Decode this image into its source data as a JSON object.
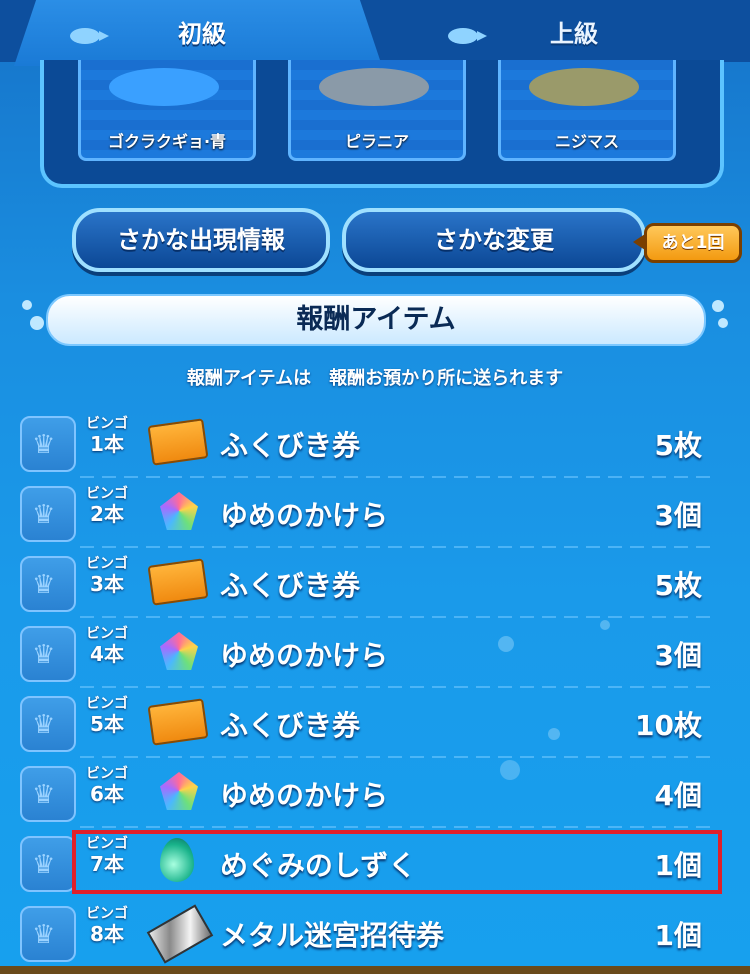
{
  "tabs": [
    {
      "label": "初級",
      "active": true,
      "icon": "fish-icon"
    },
    {
      "label": "上級",
      "active": false,
      "icon": "fish-icon"
    }
  ],
  "fish": [
    {
      "name": "ゴクラクギョ·青",
      "color": "#3aa0ff"
    },
    {
      "name": "ピラニア",
      "color": "#8a9aa8"
    },
    {
      "name": "ニジマス",
      "color": "#9a9a6a"
    }
  ],
  "buttons": {
    "appearance_info": "さかな出現情報",
    "change_fish": "さかな変更",
    "remaining": "あと1回"
  },
  "reward_section": {
    "title": "報酬アイテム",
    "note": "報酬アイテムは　報酬お預かり所に送られます"
  },
  "rewards": [
    {
      "bingo_l1": "ビンゴ",
      "bingo_l2": "1本",
      "icon": "ticket-icon",
      "name": "ふくびき券",
      "qty": "5枚"
    },
    {
      "bingo_l1": "ビンゴ",
      "bingo_l2": "2本",
      "icon": "gem-icon",
      "name": "ゆめのかけら",
      "qty": "3個"
    },
    {
      "bingo_l1": "ビンゴ",
      "bingo_l2": "3本",
      "icon": "ticket-icon",
      "name": "ふくびき券",
      "qty": "5枚"
    },
    {
      "bingo_l1": "ビンゴ",
      "bingo_l2": "4本",
      "icon": "gem-icon",
      "name": "ゆめのかけら",
      "qty": "3個"
    },
    {
      "bingo_l1": "ビンゴ",
      "bingo_l2": "5本",
      "icon": "ticket-icon",
      "name": "ふくびき券",
      "qty": "10枚"
    },
    {
      "bingo_l1": "ビンゴ",
      "bingo_l2": "6本",
      "icon": "gem-icon",
      "name": "ゆめのかけら",
      "qty": "4個"
    },
    {
      "bingo_l1": "ビンゴ",
      "bingo_l2": "7本",
      "icon": "drop-icon",
      "name": "めぐみのしずく",
      "qty": "1個",
      "highlighted": true
    },
    {
      "bingo_l1": "ビンゴ",
      "bingo_l2": "8本",
      "icon": "metal-ticket-icon",
      "name": "メタル迷宮招待券",
      "qty": "1個"
    }
  ],
  "colors": {
    "highlight": "#e0202a",
    "badge": "#f39a10"
  }
}
